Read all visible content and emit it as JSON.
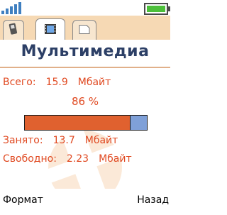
{
  "status": {
    "signal_icon": "signal-strength-icon",
    "battery_icon": "battery-icon"
  },
  "tabs": [
    {
      "icon": "phone-icon",
      "active": false
    },
    {
      "icon": "film-icon",
      "active": true
    },
    {
      "icon": "memory-card-icon",
      "active": false
    }
  ],
  "screen": {
    "title": "Мультимедиа",
    "total_label": "Всего:",
    "total_value": "15.9",
    "total_unit": "Мбайт",
    "percent": "86 %",
    "used_fraction": 0.86,
    "used_label": "Занято:",
    "used_value": "13.7",
    "used_unit": "Мбайт",
    "free_label": "Свободно:",
    "free_value": "2.23",
    "free_unit": "Мбайт"
  },
  "softkeys": {
    "left": "Формат",
    "right": "Назад"
  },
  "colors": {
    "accent": "#e04a22",
    "title": "#2c3f66",
    "used": "#e0612f",
    "free": "#7fa0d8",
    "tabstrip": "#f6d9b4"
  }
}
